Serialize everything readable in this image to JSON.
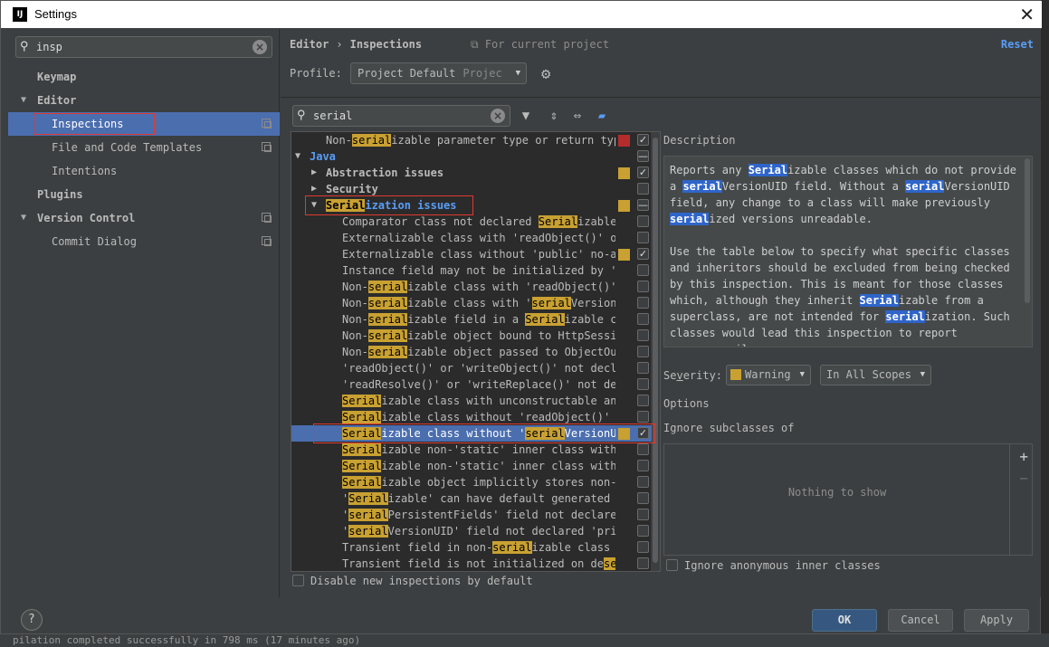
{
  "window": {
    "title": "Settings",
    "logo": "IJ"
  },
  "left": {
    "search_value": "insp",
    "nav": [
      {
        "label": "Keymap"
      },
      {
        "label": "Editor"
      },
      {
        "label": "Inspections"
      },
      {
        "label": "File and Code Templates"
      },
      {
        "label": "Intentions"
      },
      {
        "label": "Plugins"
      },
      {
        "label": "Version Control"
      },
      {
        "label": "Commit Dialog"
      }
    ]
  },
  "header": {
    "crumb_1": "Editor",
    "crumb_sep": "›",
    "crumb_2": "Inspections",
    "for_project": "For current project",
    "reset": "Reset"
  },
  "profile": {
    "label": "Profile:",
    "value": "Project Default",
    "scope": "Projec"
  },
  "inspection_search": {
    "value": "serial"
  },
  "tree": {
    "rows": [
      {
        "parts": [
          "Non-",
          "serial",
          "izable parameter type or return type"
        ],
        "sev": "#b42c2c",
        "check": "✓"
      },
      {
        "parts": [
          "Java"
        ],
        "check": "—"
      },
      {
        "parts": [
          "Abstraction issues"
        ],
        "sev": "#c9a132",
        "check": "✓"
      },
      {
        "parts": [
          "Security"
        ],
        "check": ""
      },
      {
        "parts": [
          "Serial",
          "ization issues"
        ],
        "sev": "#c9a132",
        "check": "—"
      },
      {
        "parts": [
          "Comparator class not declared ",
          "Serial",
          "izable"
        ],
        "check": ""
      },
      {
        "parts": [
          "Externalizable class with 'readObject()' or"
        ],
        "check": ""
      },
      {
        "parts": [
          "Externalizable class without 'public' no-ar"
        ],
        "sev": "#c9a132",
        "check": "✓"
      },
      {
        "parts": [
          "Instance field may not be initialized by 'r"
        ],
        "check": ""
      },
      {
        "parts": [
          "Non-",
          "serial",
          "izable class with 'readObject()'"
        ],
        "check": ""
      },
      {
        "parts": [
          "Non-",
          "serial",
          "izable class with '",
          "serial",
          "VersionU"
        ],
        "check": ""
      },
      {
        "parts": [
          "Non-",
          "serial",
          "izable field in a ",
          "Serial",
          "izable cl"
        ],
        "check": ""
      },
      {
        "parts": [
          "Non-",
          "serial",
          "izable object bound to HttpSessio"
        ],
        "check": ""
      },
      {
        "parts": [
          "Non-",
          "serial",
          "izable object passed to ObjectOut"
        ],
        "check": ""
      },
      {
        "parts": [
          "'readObject()' or 'writeObject()' not decla"
        ],
        "check": ""
      },
      {
        "parts": [
          "'readResolve()' or 'writeReplace()' not dec"
        ],
        "check": ""
      },
      {
        "parts": [
          "Serial",
          "izable class with unconstructable anc"
        ],
        "check": ""
      },
      {
        "parts": [
          "Serial",
          "izable class without 'readObject()' a"
        ],
        "check": ""
      },
      {
        "parts": [
          "Serial",
          "izable class without '",
          "serial",
          "VersionUI"
        ],
        "sev": "#c9a132",
        "check": "✓"
      },
      {
        "parts": [
          "Serial",
          "izable non-'static' inner class with"
        ],
        "check": ""
      },
      {
        "parts": [
          "Serial",
          "izable non-'static' inner class witho"
        ],
        "check": ""
      },
      {
        "parts": [
          "Serial",
          "izable object implicitly stores non-",
          "S"
        ],
        "check": ""
      },
      {
        "parts": [
          "'",
          "Serial",
          "izable' can have default generated '"
        ],
        "check": ""
      },
      {
        "parts": [
          "'",
          "serial",
          "PersistentFields' field not declared"
        ],
        "check": ""
      },
      {
        "parts": [
          "'",
          "serial",
          "VersionUID' field not declared 'priv"
        ],
        "check": ""
      },
      {
        "parts": [
          "Transient field in non-",
          "serial",
          "izable class"
        ],
        "check": ""
      },
      {
        "parts": [
          "Transient field is not initialized on de",
          "ser"
        ],
        "check": ""
      }
    ]
  },
  "disable_new": "Disable new inspections by default",
  "description": {
    "label": "Description",
    "p1": [
      "Reports any ",
      "Serial",
      "izable classes which do not provide a ",
      "serial",
      "VersionUID field. Without a ",
      "serial",
      "VersionUID field, any change to a class will make previously ",
      "serial",
      "ized versions unreadable."
    ],
    "p2": [
      "Use the table below to specify what specific classes and inheritors should be excluded from being checked by this inspection. This is meant for those classes which, although they inherit ",
      "Serial",
      "izable from a superclass, are not intended for ",
      "serial",
      "ization. Such classes would lead this inspection to report unnecessarily."
    ]
  },
  "severity": {
    "label_pre": "Se",
    "label_v": "v",
    "label_post": "erity:",
    "value": "Warning",
    "scope": "In All Scopes",
    "color": "#c9a132"
  },
  "options": {
    "label": "Options",
    "ignore_label": "Ignore subclasses of",
    "empty": "Nothing to show",
    "anon": "Ignore anonymous inner classes"
  },
  "buttons": {
    "help": "?",
    "ok": "OK",
    "cancel": "Cancel",
    "apply": "Apply"
  },
  "background": {
    "status": "pilation completed successfully in 798 ms (17 minutes ago)"
  }
}
